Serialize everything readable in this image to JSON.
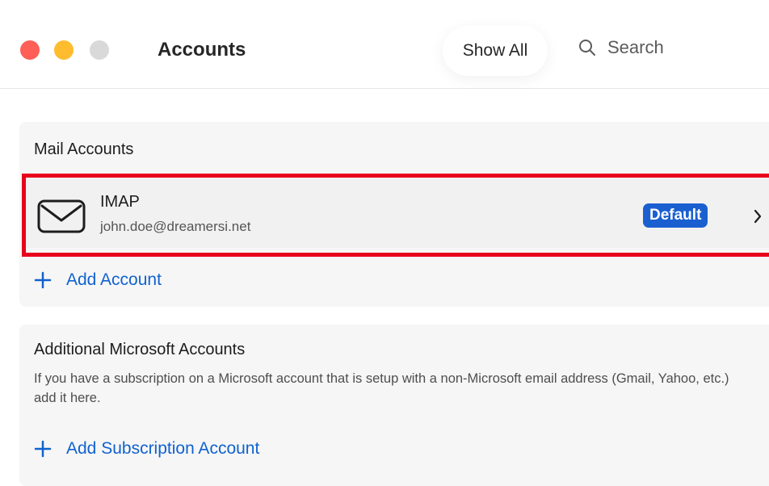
{
  "window": {
    "title": "Accounts",
    "show_all_label": "Show All",
    "search_placeholder": "Search"
  },
  "mail_accounts": {
    "section_title": "Mail Accounts",
    "account": {
      "name": "IMAP",
      "email": "john.doe@dreamersi.net",
      "badge": "Default"
    },
    "add_label": "Add Account"
  },
  "microsoft_accounts": {
    "section_title": "Additional Microsoft Accounts",
    "description": "If you have a subscription on a Microsoft account that is setup with a non-Microsoft email address (Gmail, Yahoo, etc.) add it here.",
    "add_label": "Add Subscription Account"
  },
  "colors": {
    "accent": "#1062cf",
    "badge_bg": "#1a5fd0",
    "highlight": "#e8001d",
    "close": "#fe5f57",
    "minimize": "#febc2e",
    "zoom": "#d9d9d9"
  },
  "icons": [
    "close-button",
    "minimize-button",
    "zoom-button",
    "search-icon",
    "envelope-icon",
    "chevron-right-icon",
    "plus-icon"
  ]
}
